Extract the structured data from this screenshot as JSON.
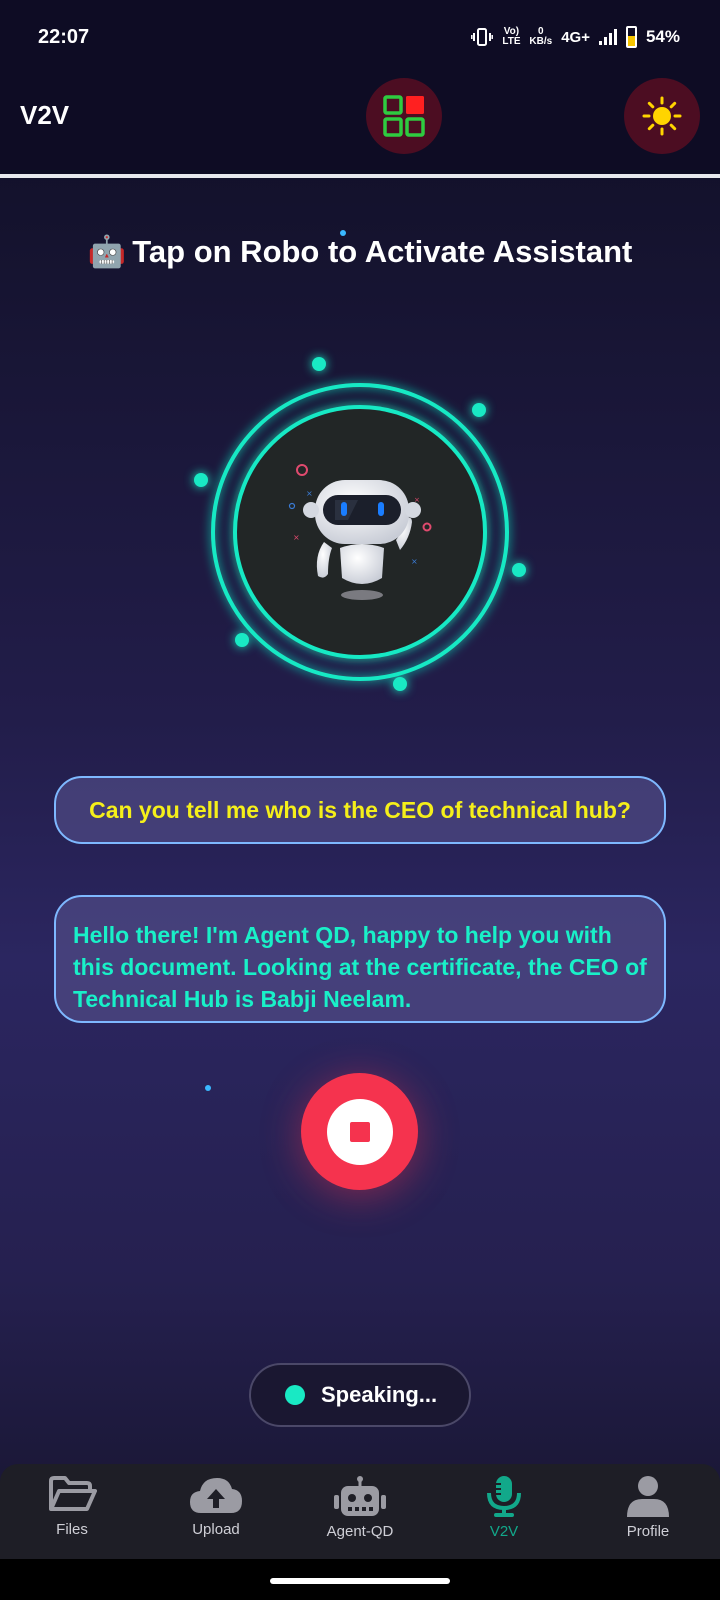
{
  "status_bar": {
    "time": "22:07",
    "volte": "Vo) LTE",
    "data_speed_value": "0",
    "data_speed_unit": "KB/s",
    "network": "4G+",
    "battery_percent": "54%",
    "battery_level": 0.54
  },
  "header": {
    "title": "V2V",
    "grid_icon": "grid-icon",
    "theme_icon": "sun-icon",
    "colors": {
      "button_bg": "#4c0d22",
      "grid_green": "#2ecc40",
      "grid_red": "#ff2020",
      "sun": "#ffd400"
    }
  },
  "main": {
    "instruction_emoji": "🤖",
    "instruction": "Tap on Robo to Activate Assistant",
    "robot_icon": "robot-avatar",
    "question": "Can you tell me who is the CEO of technical hub?",
    "answer": "Hello there! I'm Agent QD, happy to help you with this document. Looking at the certificate, the CEO of Technical Hub is Babji Neelam.",
    "stop_icon": "stop-icon",
    "status": "Speaking...",
    "colors": {
      "accent": "#19e9c4",
      "question_text": "#f5ef1a",
      "answer_text": "#19f0c8",
      "stop": "#f5334e",
      "bubble_border": "#7eb8ff"
    }
  },
  "bottom_nav": {
    "items": [
      {
        "label": "Files",
        "icon": "folder-icon",
        "active": false
      },
      {
        "label": "Upload",
        "icon": "cloud-upload-icon",
        "active": false
      },
      {
        "label": "Agent-QD",
        "icon": "robot-icon",
        "active": false
      },
      {
        "label": "V2V",
        "icon": "microphone-icon",
        "active": true
      },
      {
        "label": "Profile",
        "icon": "user-icon",
        "active": false
      }
    ],
    "active_color": "#12a88a"
  }
}
